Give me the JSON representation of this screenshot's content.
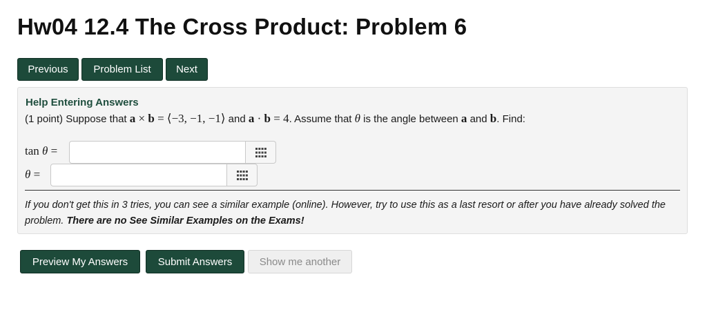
{
  "page": {
    "title": "Hw04 12.4 The Cross Product: Problem 6"
  },
  "nav": {
    "previous": "Previous",
    "problem_list": "Problem List",
    "next": "Next"
  },
  "problem": {
    "help_link": "Help Entering Answers",
    "points": "(1 point)",
    "text_1": " Suppose that ",
    "cross_a": "a",
    "cross_op": " × ",
    "cross_b": "b",
    "cross_eq": " = ⟨−3, −1, −1⟩",
    "text_and": " and ",
    "dot_a": "a",
    "dot_op": " · ",
    "dot_b": "b",
    "dot_eq": " = 4",
    "text_2": ". Assume that ",
    "theta": "θ",
    "text_3": " is the angle between ",
    "between_a": "a",
    "text_and2": " and ",
    "between_b": "b",
    "text_4": ". Find:"
  },
  "answers": [
    {
      "label_fn": "tan ",
      "label_var": "θ",
      "label_eq": " =",
      "value": ""
    },
    {
      "label_fn": "",
      "label_var": "θ",
      "label_eq": " =",
      "value": ""
    }
  ],
  "hint": {
    "text": "If you don't get this in 3 tries, you can see a similar example (online). However, try to use this as a last resort or after you have already solved the problem. ",
    "bold": "There are no See Similar Examples on the Exams!"
  },
  "actions": {
    "preview": "Preview My Answers",
    "submit": "Submit Answers",
    "show_another": "Show me another"
  },
  "colors": {
    "button_green": "#1d4a3a",
    "help_link": "#1f4e3e",
    "well_bg": "#f4f4f4",
    "disabled_bg": "#efefef"
  },
  "icons": {
    "answer_palette": "grid-icon"
  }
}
